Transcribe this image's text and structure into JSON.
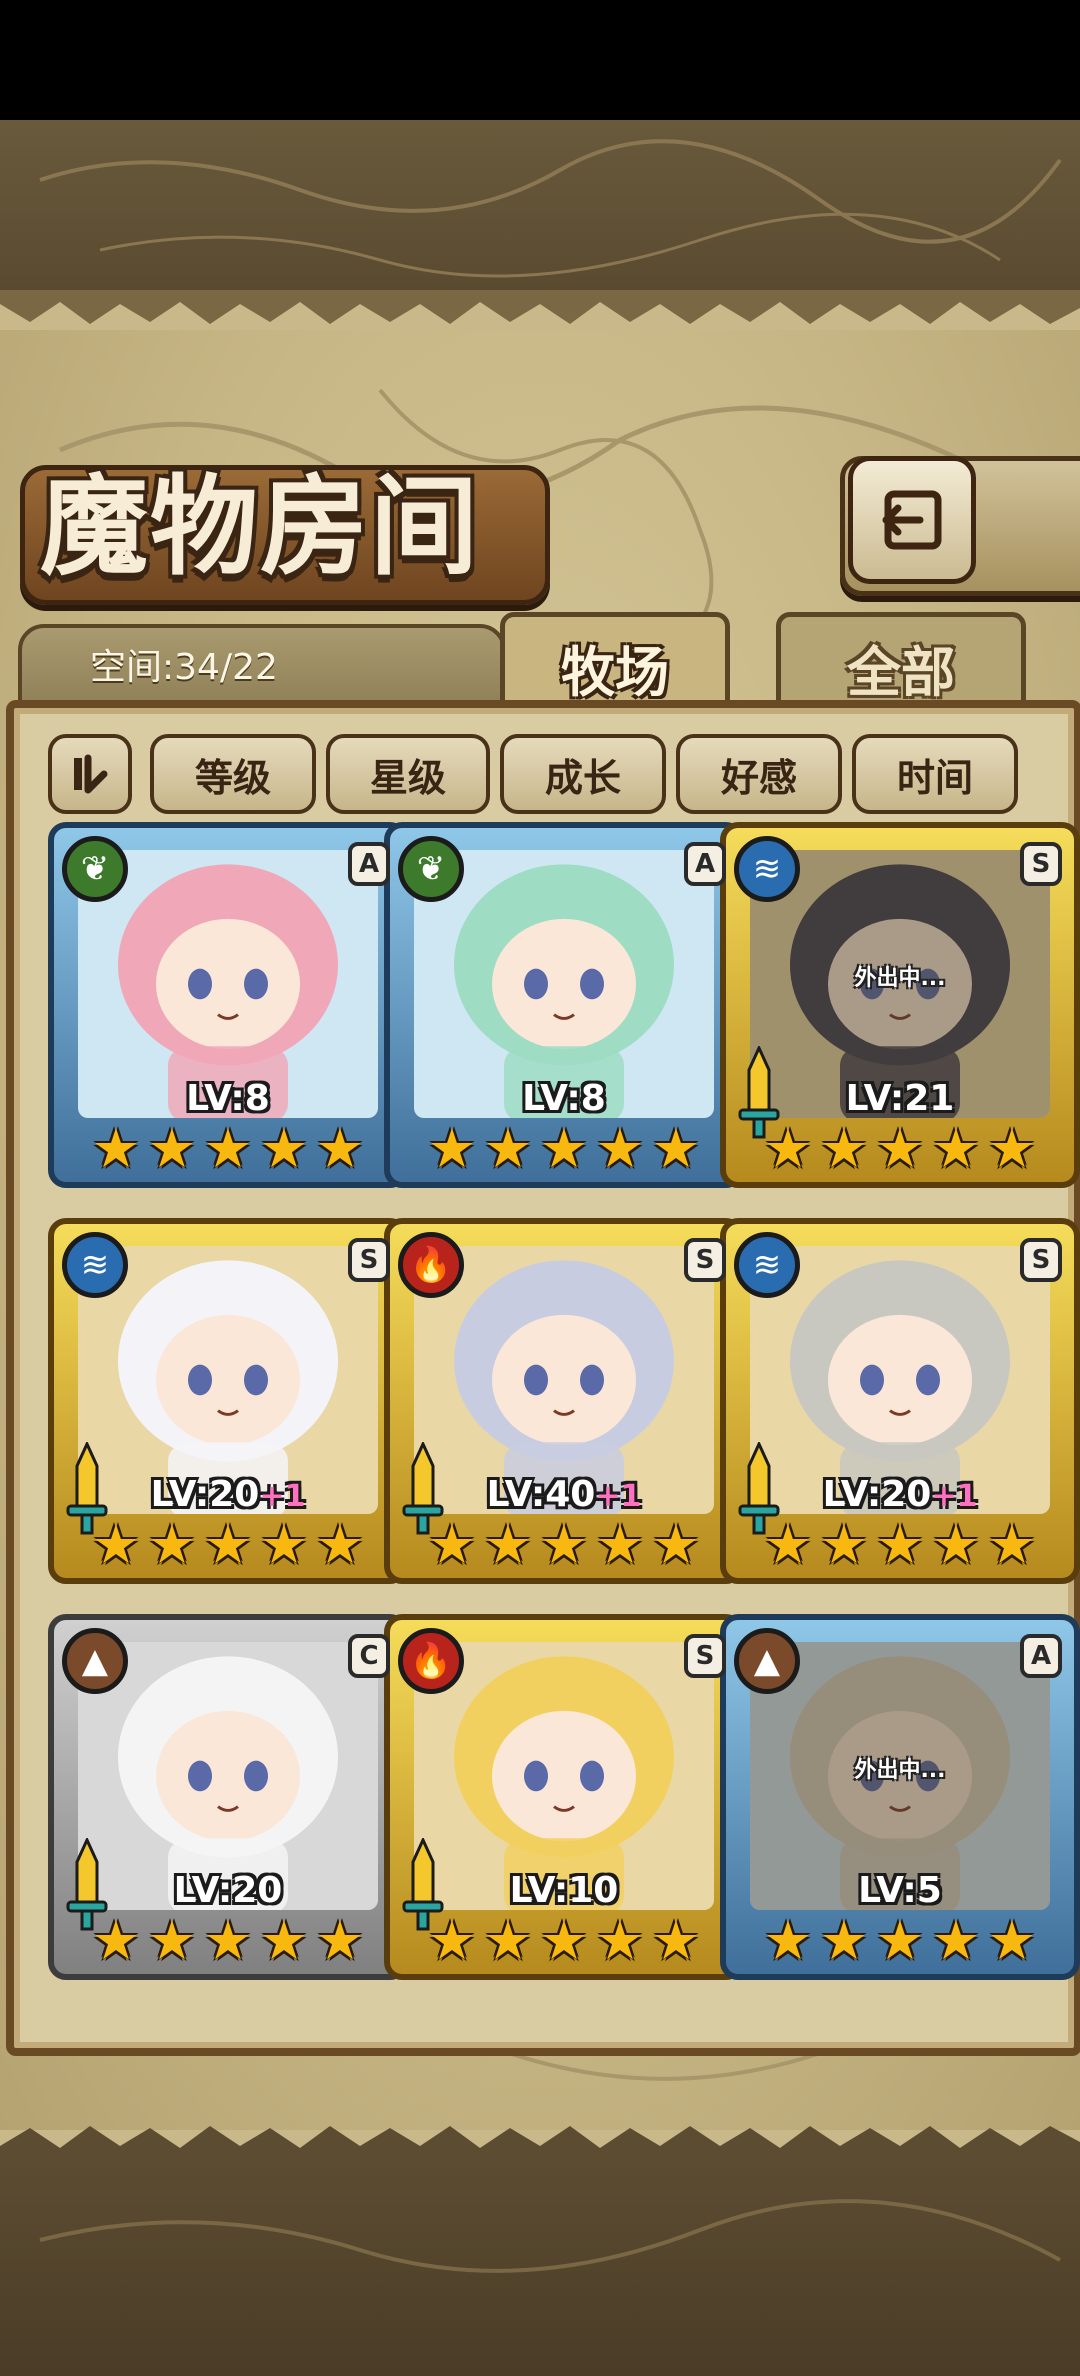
{
  "header": {
    "title": "魔物房间",
    "space_label": "空间:34/22"
  },
  "tabs": [
    {
      "label": "牧场",
      "active": true
    },
    {
      "label": "全部",
      "active": false
    }
  ],
  "sort_buttons": [
    "等级",
    "星级",
    "成长",
    "好感",
    "时间"
  ],
  "away_label": "外出中...",
  "monsters": [
    {
      "element": "leaf",
      "rank": "A",
      "frame": "blue",
      "level": "LV:8",
      "bonus": "",
      "stars": 5,
      "away": false,
      "weapon": false,
      "hair": "#f0a8b8"
    },
    {
      "element": "leaf",
      "rank": "A",
      "frame": "blue",
      "level": "LV:8",
      "bonus": "",
      "stars": 5,
      "away": false,
      "weapon": false,
      "hair": "#9fdcc4"
    },
    {
      "element": "water",
      "rank": "S",
      "frame": "gold",
      "level": "LV:21",
      "bonus": "",
      "stars": 5,
      "away": true,
      "weapon": true,
      "hair": "#3c3c50"
    },
    {
      "element": "water",
      "rank": "S",
      "frame": "gold",
      "level": "LV:20",
      "bonus": "+1",
      "stars": 5,
      "away": false,
      "weapon": true,
      "hair": "#f4f4f8"
    },
    {
      "element": "fire",
      "rank": "S",
      "frame": "gold",
      "level": "LV:40",
      "bonus": "+1",
      "stars": 5,
      "away": false,
      "weapon": true,
      "hair": "#c8cce0"
    },
    {
      "element": "water",
      "rank": "S",
      "frame": "gold",
      "level": "LV:20",
      "bonus": "+1",
      "stars": 5,
      "away": false,
      "weapon": true,
      "hair": "#c8c8c0"
    },
    {
      "element": "earth",
      "rank": "C",
      "frame": "silver",
      "level": "LV:20",
      "bonus": "",
      "stars": 5,
      "away": false,
      "weapon": true,
      "hair": "#f4f4f4"
    },
    {
      "element": "fire",
      "rank": "S",
      "frame": "gold",
      "level": "LV:10",
      "bonus": "",
      "stars": 5,
      "away": false,
      "weapon": true,
      "hair": "#f2d060"
    },
    {
      "element": "earth",
      "rank": "A",
      "frame": "blue",
      "level": "LV:5",
      "bonus": "",
      "stars": 5,
      "away": true,
      "weapon": false,
      "hair": "#d8d0c0"
    }
  ],
  "icons": {
    "leaf": "leaf-icon",
    "water": "water-wave-icon",
    "fire": "flame-icon",
    "earth": "mountain-icon"
  },
  "colors": {
    "panel_border": "#6a4a25",
    "blue_frame": "#3f6f9a",
    "gold_frame": "#d8b43a",
    "silver_frame": "#a0a0a0",
    "level_bonus": "#ff70c0"
  }
}
